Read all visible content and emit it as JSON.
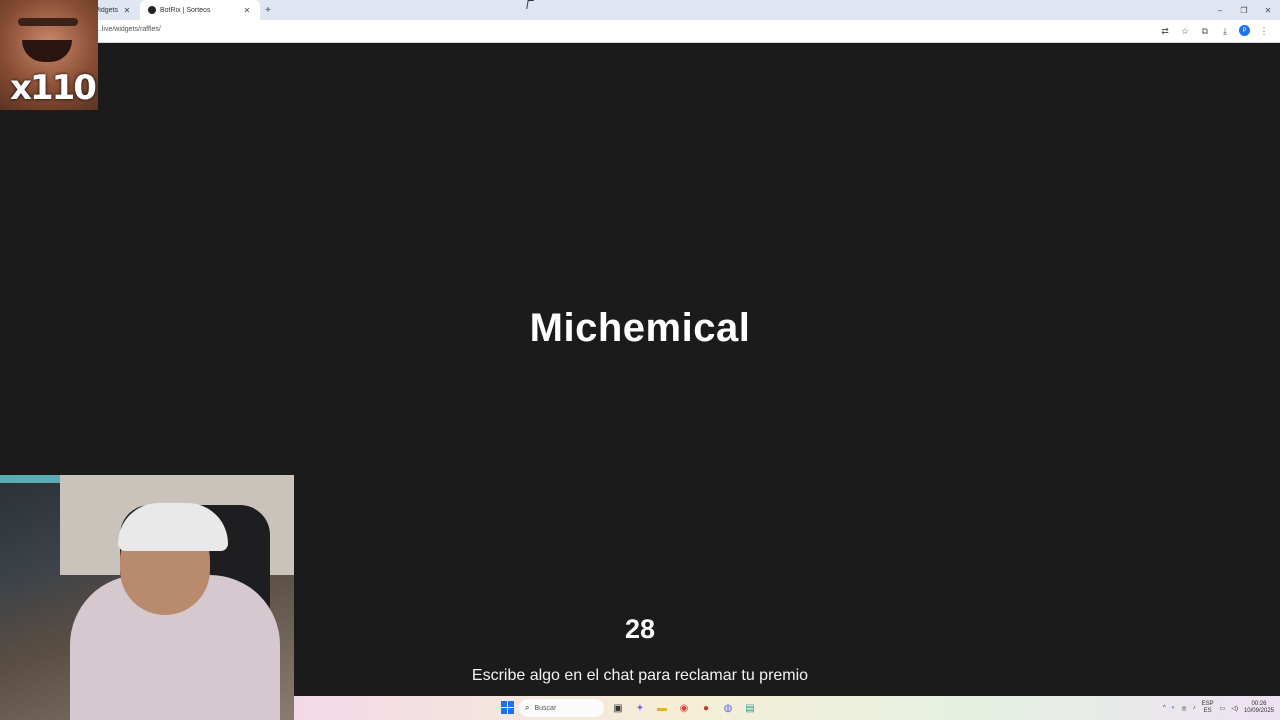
{
  "browser": {
    "tabs": [
      {
        "label": "Widgets",
        "active": false
      },
      {
        "label": "BotRix | Sorteos",
        "active": true
      }
    ],
    "new_tab": "+",
    "url": "...live/widgets/raffles/",
    "window_controls": {
      "minimize": "–",
      "restore": "❐",
      "close": "✕"
    },
    "toolbar_icons": [
      "translate-icon",
      "star-icon",
      "extensions-icon",
      "download-icon",
      "profile-icon",
      "menu-icon"
    ]
  },
  "raffle": {
    "winner": "Michemical",
    "countdown": "28",
    "message": "Escribe algo en el chat para reclamar tu premio"
  },
  "overlay": {
    "emote_count": "x110"
  },
  "taskbar": {
    "search_placeholder": "Buscar",
    "language": {
      "line1": "ESP",
      "line2": "ES"
    },
    "clock": {
      "time": "00:26",
      "date": "10/09/2025"
    }
  },
  "colors": {
    "page_background": "#1c1b1b",
    "text": "#ffffff",
    "tabbar": "#dfe6f2",
    "accent": "#1a73e8"
  }
}
